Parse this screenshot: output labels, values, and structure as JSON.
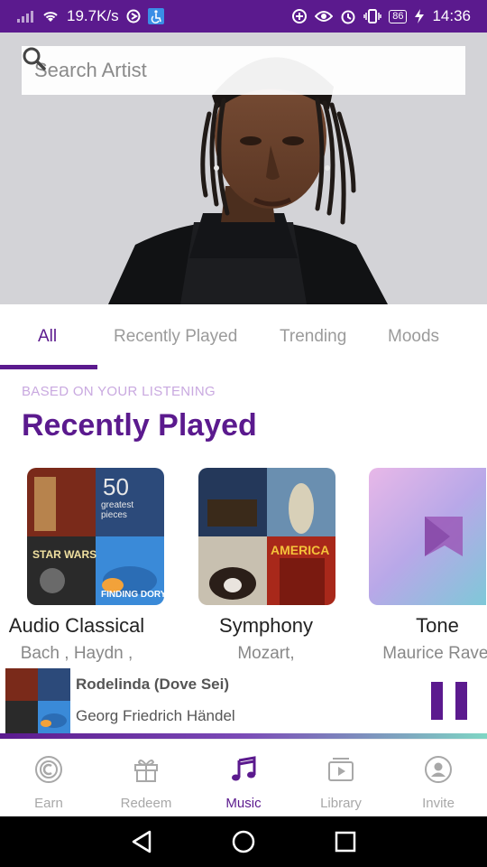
{
  "status_bar": {
    "network_speed": "19.7K/s",
    "battery": "86",
    "time": "14:36"
  },
  "search": {
    "placeholder": "Search Artist"
  },
  "tabs": [
    {
      "label": "All",
      "active": true
    },
    {
      "label": "Recently Played",
      "active": false
    },
    {
      "label": "Trending",
      "active": false
    },
    {
      "label": "Moods",
      "active": false
    }
  ],
  "section": {
    "subtitle": "BASED ON YOUR LISTENING",
    "title": "Recently Played"
  },
  "cards": [
    {
      "title": "Audio Classical",
      "artist": "Bach , Haydn ,",
      "art_text_1": "50",
      "art_text_2": "greatest",
      "art_text_3": "pieces",
      "art_text_4": "STAR WARS",
      "art_text_5": "FINDING DORY"
    },
    {
      "title": "Symphony",
      "artist": "Mozart,",
      "art_text_1": "AMERICA"
    },
    {
      "title": "Tone",
      "artist": "Maurice Ravel"
    }
  ],
  "now_playing": {
    "title": "Rodelinda (Dove Sei)",
    "artist": "Georg Friedrich Händel",
    "progress": 1.0
  },
  "bottom_nav": [
    {
      "label": "Earn",
      "icon": "earn-coin-icon",
      "active": false
    },
    {
      "label": "Redeem",
      "icon": "gift-icon",
      "active": false
    },
    {
      "label": "Music",
      "icon": "music-note-icon",
      "active": true
    },
    {
      "label": "Library",
      "icon": "library-play-icon",
      "active": false
    },
    {
      "label": "Invite",
      "icon": "invite-user-icon",
      "active": false
    }
  ],
  "colors": {
    "accent": "#5b1a8e",
    "status_bar": "#5b1a8e",
    "subtitle": "#c9a9e0",
    "inactive": "#9b9b9b"
  }
}
